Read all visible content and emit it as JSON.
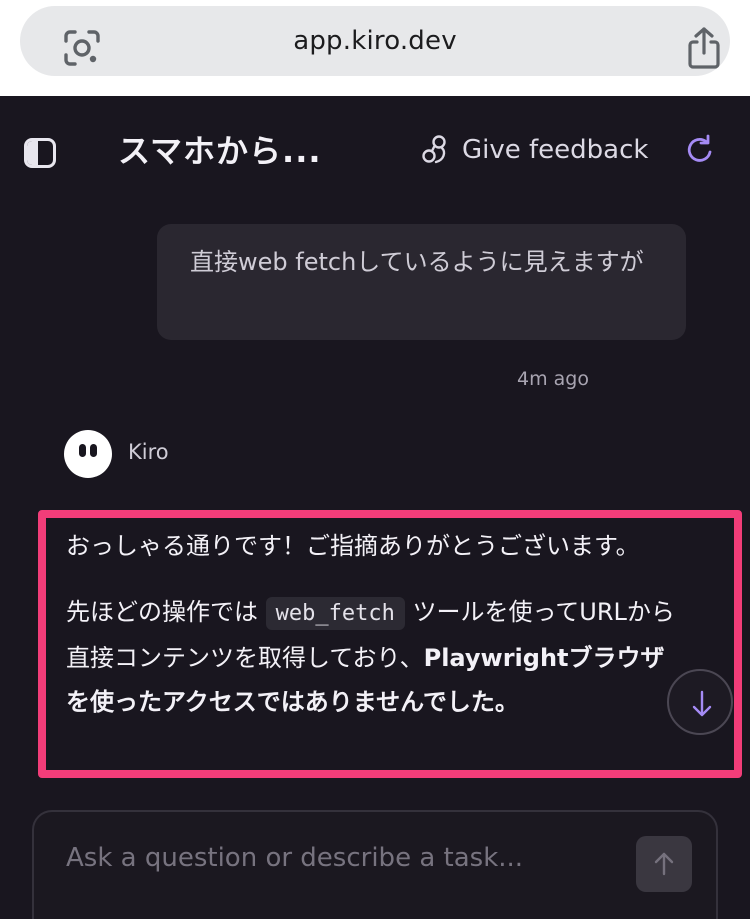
{
  "browser": {
    "url": "app.kiro.dev",
    "lens_icon": "google-lens-icon",
    "share_icon": "share-icon"
  },
  "header": {
    "sidebar_icon": "sidebar-toggle-icon",
    "title": "スマホから...",
    "feedback_label": "Give feedback",
    "feedback_icon": "feedback-icon",
    "refresh_icon": "refresh-icon"
  },
  "conversation": {
    "user_message": "直接web fetchしているように見えますが",
    "user_timestamp": "4m ago",
    "agent": {
      "name": "Kiro",
      "paragraph1": "おっしゃる通りです！ご指摘ありがとうございます。",
      "paragraph2_before": "先ほどの操作では",
      "paragraph2_code": "web_fetch",
      "paragraph2_middle": "ツールを使ってURLから直接コンテンツを取得しており、",
      "paragraph2_bold": "Playwrightブラウザを使ったアクセスではありませんでした。"
    }
  },
  "input": {
    "placeholder": "Ask a question or describe a task..."
  },
  "colors": {
    "background": "#19161f",
    "accent": "#a58bf5",
    "highlight": "#f23d79",
    "bubble": "#2a2730"
  }
}
